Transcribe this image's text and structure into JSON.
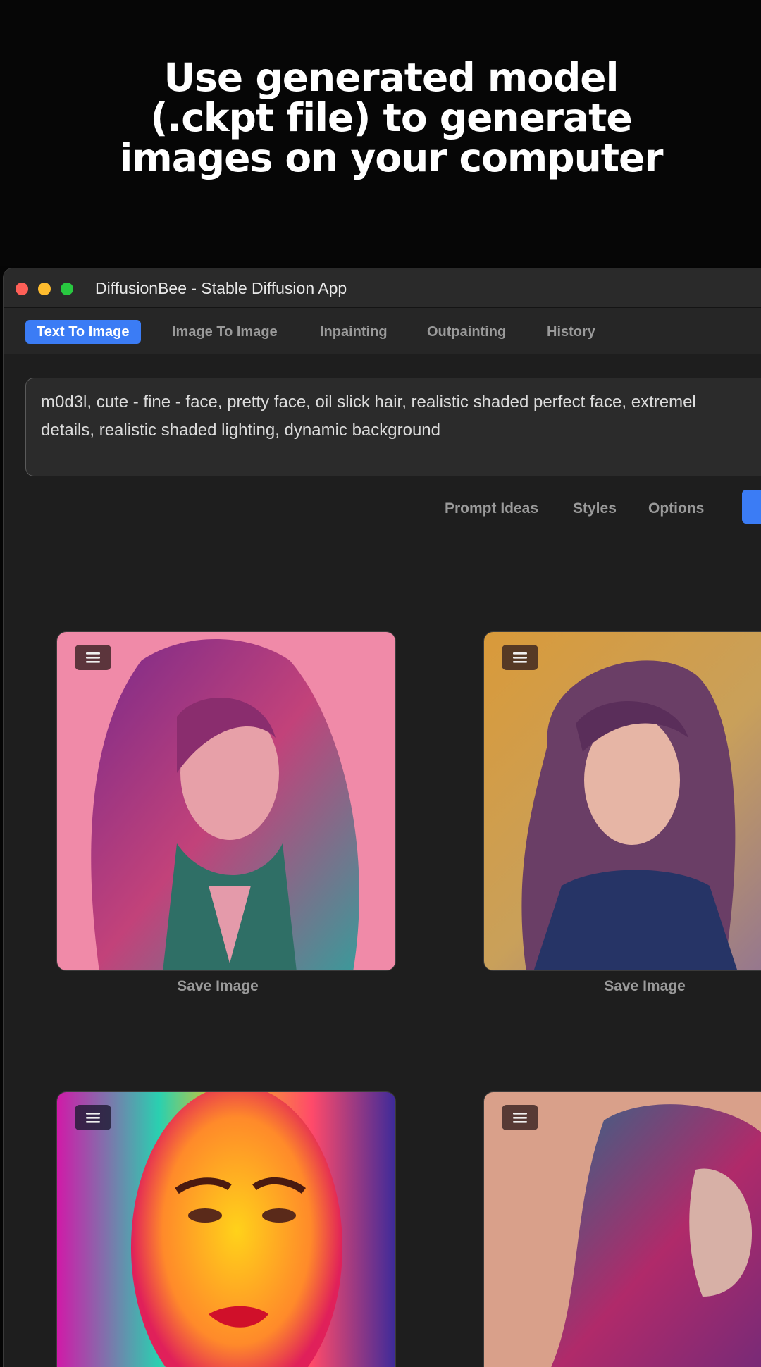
{
  "hero": {
    "title_lines": [
      "Use generated model",
      "(.ckpt file) to generate",
      "images on your computer"
    ]
  },
  "window": {
    "title": "DiffusionBee - Stable Diffusion App",
    "tabs": [
      {
        "label": "Text To Image",
        "active": true
      },
      {
        "label": "Image To Image",
        "active": false
      },
      {
        "label": "Inpainting",
        "active": false
      },
      {
        "label": "Outpainting",
        "active": false
      },
      {
        "label": "History",
        "active": false
      }
    ],
    "prompt": {
      "lines": [
        "m0d3l, cute - fine - face, pretty face, oil slick hair, realistic shaded perfect face, extremel",
        "details, realistic shaded lighting, dynamic background"
      ]
    },
    "actions": {
      "prompt_ideas": "Prompt Ideas",
      "styles": "Styles",
      "options": "Options"
    },
    "images": [
      {
        "save_label": "Save Image",
        "menu_icon": "hamburger-menu-icon"
      },
      {
        "save_label": "Save Image",
        "menu_icon": "hamburger-menu-icon"
      },
      {
        "save_label": "",
        "menu_icon": "hamburger-menu-icon"
      },
      {
        "save_label": "",
        "menu_icon": "hamburger-menu-icon"
      }
    ]
  },
  "colors": {
    "accent": "#3b7cf5",
    "window_bg": "#1e1e1e",
    "hero_bg": "#060606"
  }
}
